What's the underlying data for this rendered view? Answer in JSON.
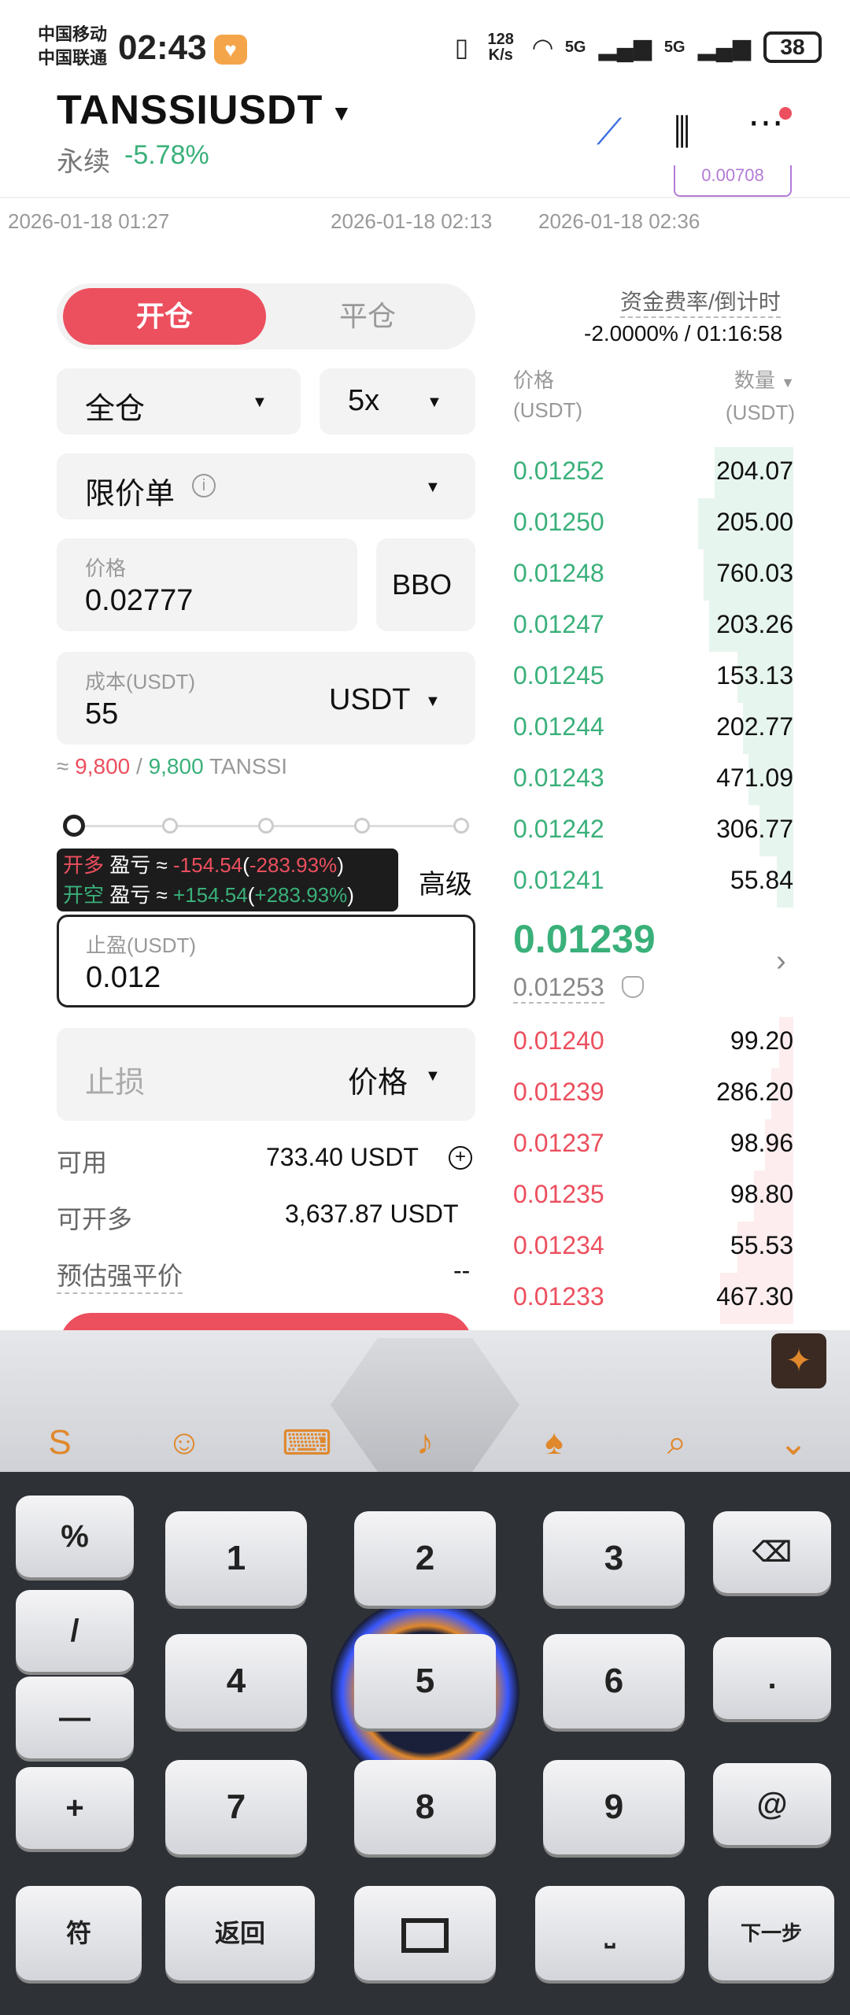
{
  "status_bar": {
    "carrier1": "中国移动",
    "carrier2": "中国联通",
    "time": "02:43",
    "net_speed": "128 K/s",
    "signal1": "5G",
    "signal2": "5G",
    "battery": "38"
  },
  "header": {
    "symbol": "TANSSIUSDT",
    "market_type": "永续",
    "change": "-5.78%"
  },
  "chart_axis": {
    "times": [
      "2026-01-18 01:27",
      "2026-01-18 02:13",
      "2026-01-18 02:36"
    ],
    "partial_value": "0.00708"
  },
  "form": {
    "tab_open": "开仓",
    "tab_close": "平仓",
    "margin_mode": "全仓",
    "leverage": "5x",
    "order_type": "限价单",
    "price_label": "价格",
    "price_value": "0.02777",
    "bbo": "BBO",
    "cost_label": "成本(USDT)",
    "cost_value": "55",
    "cost_unit": "USDT",
    "estimate_prefix": "≈",
    "estimate_long": "9,800",
    "estimate_sep": "/",
    "estimate_short": "9,800",
    "estimate_unit": "TANSSI",
    "tip_long_label": "开多",
    "tip_short_label": "开空",
    "tip_pnl_label": "盈亏",
    "tip_approx": "≈",
    "tip_long_pnl": "-154.54",
    "tip_long_pct": "-283.93%",
    "tip_short_pnl": "+154.54",
    "tip_short_pct": "+283.93%",
    "advanced": "高级",
    "tp_label": "止盈(USDT)",
    "tp_value": "0.012",
    "sl_label": "止损",
    "sl_mode": "价格",
    "available_label": "可用",
    "available_value": "733.40 USDT",
    "max_open_label": "可开多",
    "max_open_value": "3,637.87 USDT",
    "liq_label": "预估强平价",
    "liq_value": "--"
  },
  "orderbook": {
    "funding_label": "资金费率/倒计时",
    "funding_value": "-2.0000% / 01:16:58",
    "price_header": "价格",
    "price_unit": "(USDT)",
    "qty_header": "数量",
    "qty_unit": "(USDT)",
    "asks": [
      {
        "price": "0.01252",
        "qty": "204.07",
        "depth": 0.28
      },
      {
        "price": "0.01250",
        "qty": "205.00",
        "depth": 0.34
      },
      {
        "price": "0.01248",
        "qty": "760.03",
        "depth": 0.32
      },
      {
        "price": "0.01247",
        "qty": "203.26",
        "depth": 0.3
      },
      {
        "price": "0.01245",
        "qty": "153.13",
        "depth": 0.2
      },
      {
        "price": "0.01244",
        "qty": "202.77",
        "depth": 0.18
      },
      {
        "price": "0.01243",
        "qty": "471.09",
        "depth": 0.16
      },
      {
        "price": "0.01242",
        "qty": "306.77",
        "depth": 0.12
      },
      {
        "price": "0.01241",
        "qty": "55.84",
        "depth": 0.06
      }
    ],
    "last_price": "0.01239",
    "mark_price": "0.01253",
    "bids": [
      {
        "price": "0.01240",
        "qty": "99.20",
        "depth": 0.05
      },
      {
        "price": "0.01239",
        "qty": "286.20",
        "depth": 0.08
      },
      {
        "price": "0.01237",
        "qty": "98.96",
        "depth": 0.1
      },
      {
        "price": "0.01235",
        "qty": "98.80",
        "depth": 0.14
      },
      {
        "price": "0.01234",
        "qty": "55.53",
        "depth": 0.2
      },
      {
        "price": "0.01233",
        "qty": "467.30",
        "depth": 0.26
      }
    ]
  },
  "keyboard": {
    "keys": {
      "k1": "1",
      "k2": "2",
      "k3": "3",
      "k4": "4",
      "k5": "5",
      "k6": "6",
      "k7": "7",
      "k8": "8",
      "k9": "9",
      "percent": "%",
      "slash": "/",
      "minus": "—",
      "plus": "+",
      "dot": ".",
      "at": "@",
      "symbols": "符",
      "back": "返回",
      "next": "下一步"
    }
  },
  "colors": {
    "buy": "#3ab07a",
    "sell": "#ec4f5e",
    "accent_keyboard": "#e0882c"
  }
}
